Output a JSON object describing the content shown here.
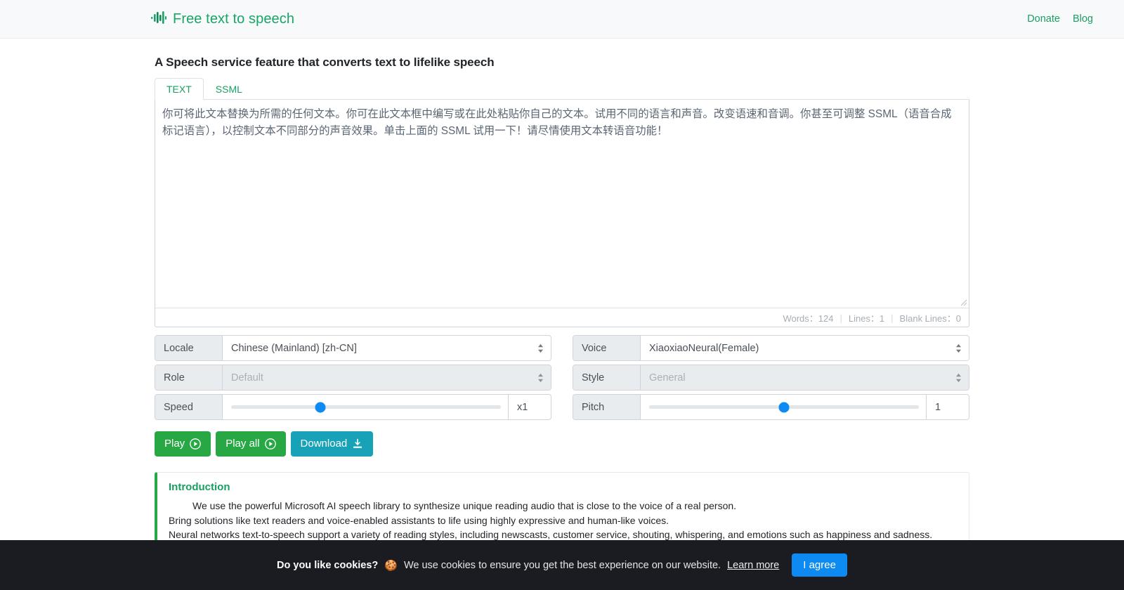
{
  "header": {
    "logo_icon": "audio-wave-icon",
    "brand": "Free text to speech",
    "nav": [
      {
        "label": "Donate"
      },
      {
        "label": "Blog"
      }
    ]
  },
  "main": {
    "page_title": "A Speech service feature that converts text to lifelike speech",
    "tabs": [
      {
        "label": "TEXT",
        "active": true
      },
      {
        "label": "SSML",
        "active": false
      }
    ],
    "editor": {
      "value": "你可将此文本替换为所需的任何文本。你可在此文本框中编写或在此处粘贴你自己的文本。试用不同的语言和声音。改变语速和音调。你甚至可调整 SSML（语音合成标记语言），以控制文本不同部分的声音效果。单击上面的 SSML 试用一下！请尽情使用文本转语音功能！",
      "placeholder": ""
    },
    "stats": {
      "words_label": "Words：124",
      "lines_label": "Lines：1",
      "blank_lines_label": "Blank Lines：0",
      "separator": "|"
    },
    "controls": {
      "locale": {
        "label": "Locale",
        "value": "Chinese (Mainland) [zh-CN]"
      },
      "voice": {
        "label": "Voice",
        "value": "XiaoxiaoNeural(Female)"
      },
      "role": {
        "label": "Role",
        "value": "Default",
        "disabled": true
      },
      "style": {
        "label": "Style",
        "value": "General",
        "disabled": true
      },
      "speed": {
        "label": "Speed",
        "value": "x1",
        "percent": 33
      },
      "pitch": {
        "label": "Pitch",
        "value": "1",
        "percent": 50
      }
    },
    "buttons": [
      {
        "label": "Play",
        "icon": "play-circle-icon",
        "color": "#28a745"
      },
      {
        "label": "Play all",
        "icon": "play-circle-icon",
        "color": "#28a745"
      },
      {
        "label": "Download",
        "icon": "download-icon",
        "color": "#17a2b8"
      }
    ],
    "introduction": {
      "title": "Introduction",
      "paragraphs": [
        "We use the powerful Microsoft AI speech library to synthesize unique reading audio that is close to the voice of a real person.",
        "Bring solutions like text readers and voice-enabled assistants to life using highly expressive and human-like voices.",
        "Neural networks text-to-speech support a variety of reading styles, including newscasts, customer service, shouting, whispering, and emotions such as happiness and sadness."
      ]
    }
  },
  "cookie_banner": {
    "question": "Do you like cookies?",
    "emoji": "🍪",
    "message": "We use cookies to ensure you get the best experience on our website.",
    "learn_more": "Learn more",
    "agree_label": "I agree"
  },
  "colors": {
    "brand_green": "#18a566",
    "button_green": "#28a745",
    "button_blue": "#17a2b8",
    "slider_blue": "#0d8bf2",
    "banner_bg": "#1b1b22"
  }
}
